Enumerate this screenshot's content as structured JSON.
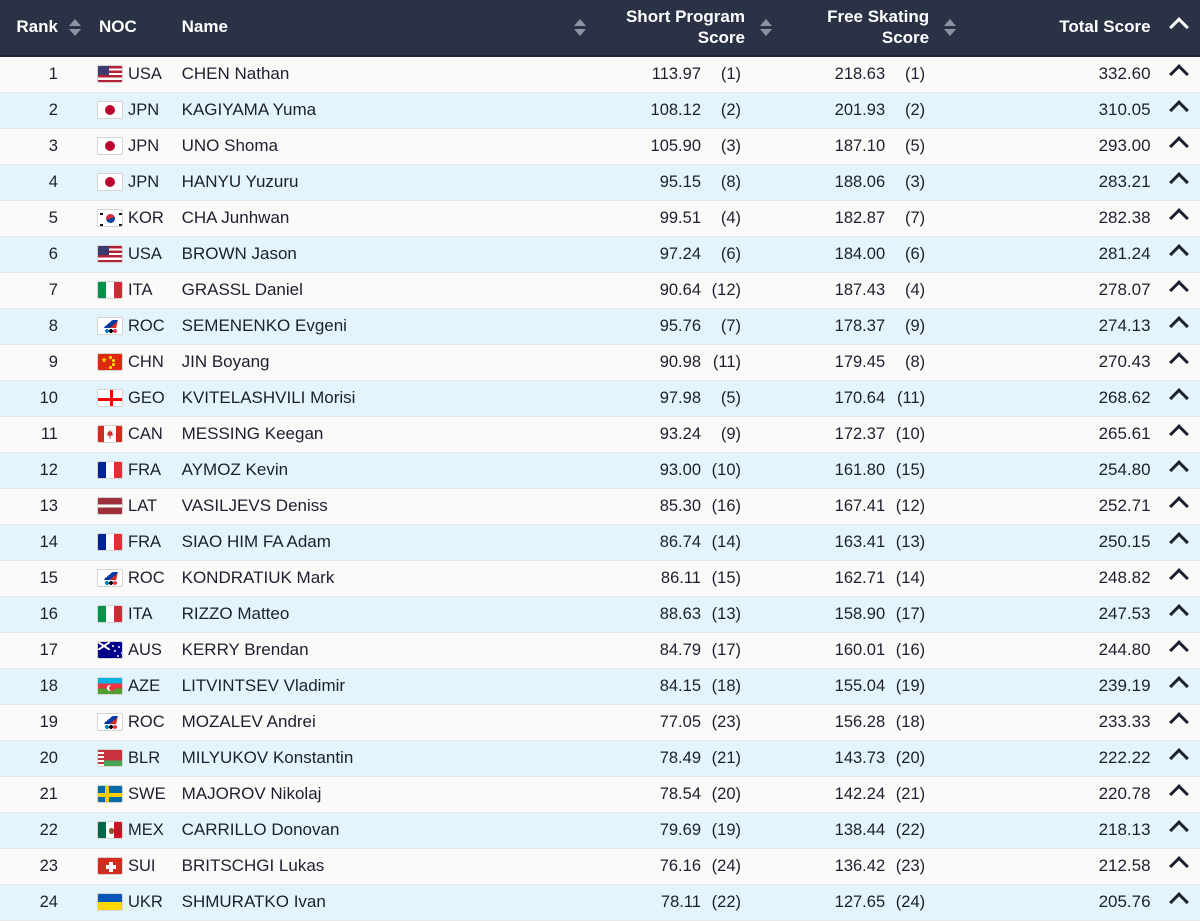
{
  "table": {
    "columns": {
      "rank": "Rank",
      "noc": "NOC",
      "name": "Name",
      "short_program": "Short Program Score",
      "short_program_line1": "Short Program",
      "short_program_line2": "Score",
      "free_skating": "Free Skating Score",
      "free_skating_line1": "Free Skating",
      "free_skating_line2": "Score",
      "total": "Total Score"
    },
    "sort": {
      "active_column": "Total Score",
      "active_direction": "ascending",
      "active_icon": "chevron-up-icon",
      "inactive_icon": "sort-both-icon"
    },
    "colors": {
      "header_background": "#2b3245",
      "header_text": "#ffffff",
      "row_odd": "#fbfaf9",
      "row_even": "#e4f4fd",
      "row_text": "#1b2030",
      "row_border": "#e7e7e7"
    },
    "row_expand_icon": "chevron-up-icon",
    "rows": [
      {
        "rank": "1",
        "noc": "USA",
        "flag": "f-usa",
        "name": "CHEN Nathan",
        "sp": "113.97",
        "sp_rank": "(1)",
        "fs": "218.63",
        "fs_rank": "(1)",
        "total": "332.60"
      },
      {
        "rank": "2",
        "noc": "JPN",
        "flag": "f-jpn",
        "name": "KAGIYAMA Yuma",
        "sp": "108.12",
        "sp_rank": "(2)",
        "fs": "201.93",
        "fs_rank": "(2)",
        "total": "310.05"
      },
      {
        "rank": "3",
        "noc": "JPN",
        "flag": "f-jpn",
        "name": "UNO Shoma",
        "sp": "105.90",
        "sp_rank": "(3)",
        "fs": "187.10",
        "fs_rank": "(5)",
        "total": "293.00"
      },
      {
        "rank": "4",
        "noc": "JPN",
        "flag": "f-jpn",
        "name": "HANYU Yuzuru",
        "sp": "95.15",
        "sp_rank": "(8)",
        "fs": "188.06",
        "fs_rank": "(3)",
        "total": "283.21"
      },
      {
        "rank": "5",
        "noc": "KOR",
        "flag": "f-kor",
        "name": "CHA Junhwan",
        "sp": "99.51",
        "sp_rank": "(4)",
        "fs": "182.87",
        "fs_rank": "(7)",
        "total": "282.38"
      },
      {
        "rank": "6",
        "noc": "USA",
        "flag": "f-usa",
        "name": "BROWN Jason",
        "sp": "97.24",
        "sp_rank": "(6)",
        "fs": "184.00",
        "fs_rank": "(6)",
        "total": "281.24"
      },
      {
        "rank": "7",
        "noc": "ITA",
        "flag": "f-ita",
        "name": "GRASSL Daniel",
        "sp": "90.64",
        "sp_rank": "(12)",
        "fs": "187.43",
        "fs_rank": "(4)",
        "total": "278.07"
      },
      {
        "rank": "8",
        "noc": "ROC",
        "flag": "f-roc",
        "name": "SEMENENKO Evgeni",
        "sp": "95.76",
        "sp_rank": "(7)",
        "fs": "178.37",
        "fs_rank": "(9)",
        "total": "274.13"
      },
      {
        "rank": "9",
        "noc": "CHN",
        "flag": "f-chn",
        "name": "JIN Boyang",
        "sp": "90.98",
        "sp_rank": "(11)",
        "fs": "179.45",
        "fs_rank": "(8)",
        "total": "270.43"
      },
      {
        "rank": "10",
        "noc": "GEO",
        "flag": "f-geo",
        "name": "KVITELASHVILI Morisi",
        "sp": "97.98",
        "sp_rank": "(5)",
        "fs": "170.64",
        "fs_rank": "(11)",
        "total": "268.62"
      },
      {
        "rank": "11",
        "noc": "CAN",
        "flag": "f-can",
        "name": "MESSING Keegan",
        "sp": "93.24",
        "sp_rank": "(9)",
        "fs": "172.37",
        "fs_rank": "(10)",
        "total": "265.61"
      },
      {
        "rank": "12",
        "noc": "FRA",
        "flag": "f-fra",
        "name": "AYMOZ Kevin",
        "sp": "93.00",
        "sp_rank": "(10)",
        "fs": "161.80",
        "fs_rank": "(15)",
        "total": "254.80"
      },
      {
        "rank": "13",
        "noc": "LAT",
        "flag": "f-lat",
        "name": "VASILJEVS Deniss",
        "sp": "85.30",
        "sp_rank": "(16)",
        "fs": "167.41",
        "fs_rank": "(12)",
        "total": "252.71"
      },
      {
        "rank": "14",
        "noc": "FRA",
        "flag": "f-fra",
        "name": "SIAO HIM FA Adam",
        "sp": "86.74",
        "sp_rank": "(14)",
        "fs": "163.41",
        "fs_rank": "(13)",
        "total": "250.15"
      },
      {
        "rank": "15",
        "noc": "ROC",
        "flag": "f-roc",
        "name": "KONDRATIUK Mark",
        "sp": "86.11",
        "sp_rank": "(15)",
        "fs": "162.71",
        "fs_rank": "(14)",
        "total": "248.82"
      },
      {
        "rank": "16",
        "noc": "ITA",
        "flag": "f-ita",
        "name": "RIZZO Matteo",
        "sp": "88.63",
        "sp_rank": "(13)",
        "fs": "158.90",
        "fs_rank": "(17)",
        "total": "247.53"
      },
      {
        "rank": "17",
        "noc": "AUS",
        "flag": "f-aus",
        "name": "KERRY Brendan",
        "sp": "84.79",
        "sp_rank": "(17)",
        "fs": "160.01",
        "fs_rank": "(16)",
        "total": "244.80"
      },
      {
        "rank": "18",
        "noc": "AZE",
        "flag": "f-aze",
        "name": "LITVINTSEV Vladimir",
        "sp": "84.15",
        "sp_rank": "(18)",
        "fs": "155.04",
        "fs_rank": "(19)",
        "total": "239.19"
      },
      {
        "rank": "19",
        "noc": "ROC",
        "flag": "f-roc",
        "name": "MOZALEV Andrei",
        "sp": "77.05",
        "sp_rank": "(23)",
        "fs": "156.28",
        "fs_rank": "(18)",
        "total": "233.33"
      },
      {
        "rank": "20",
        "noc": "BLR",
        "flag": "f-blr",
        "name": "MILYUKOV Konstantin",
        "sp": "78.49",
        "sp_rank": "(21)",
        "fs": "143.73",
        "fs_rank": "(20)",
        "total": "222.22"
      },
      {
        "rank": "21",
        "noc": "SWE",
        "flag": "f-swe",
        "name": "MAJOROV Nikolaj",
        "sp": "78.54",
        "sp_rank": "(20)",
        "fs": "142.24",
        "fs_rank": "(21)",
        "total": "220.78"
      },
      {
        "rank": "22",
        "noc": "MEX",
        "flag": "f-mex",
        "name": "CARRILLO Donovan",
        "sp": "79.69",
        "sp_rank": "(19)",
        "fs": "138.44",
        "fs_rank": "(22)",
        "total": "218.13"
      },
      {
        "rank": "23",
        "noc": "SUI",
        "flag": "f-sui",
        "name": "BRITSCHGI Lukas",
        "sp": "76.16",
        "sp_rank": "(24)",
        "fs": "136.42",
        "fs_rank": "(23)",
        "total": "212.58"
      },
      {
        "rank": "24",
        "noc": "UKR",
        "flag": "f-ukr",
        "name": "SHMURATKO Ivan",
        "sp": "78.11",
        "sp_rank": "(22)",
        "fs": "127.65",
        "fs_rank": "(24)",
        "total": "205.76"
      }
    ]
  }
}
